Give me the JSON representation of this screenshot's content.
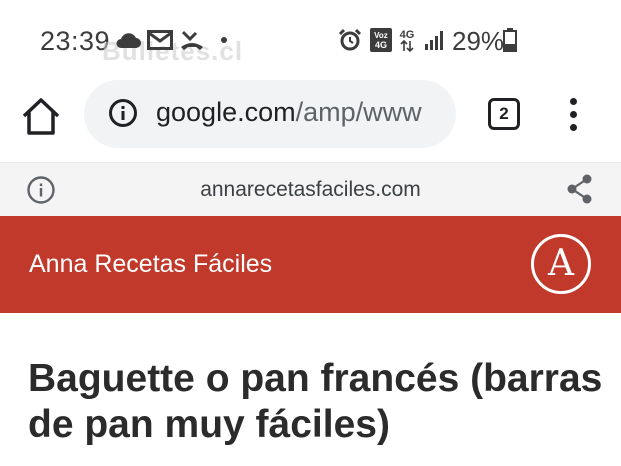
{
  "status_bar": {
    "time": "23:39",
    "watermark": "Bulletes.cl",
    "battery": "29%",
    "network_label_top": "Voz",
    "network_label_bottom": "4G",
    "signal_label": "4G"
  },
  "browser": {
    "url_domain": "google.com",
    "url_path": "/amp/www",
    "tab_count": "2"
  },
  "amp_bar": {
    "domain": "annarecetasfaciles.com"
  },
  "site": {
    "name": "Anna Recetas Fáciles",
    "logo_letter": "A",
    "brand_color": "#c0392b"
  },
  "article": {
    "title": "Baguette o pan francés (barras de pan muy fáciles)"
  }
}
